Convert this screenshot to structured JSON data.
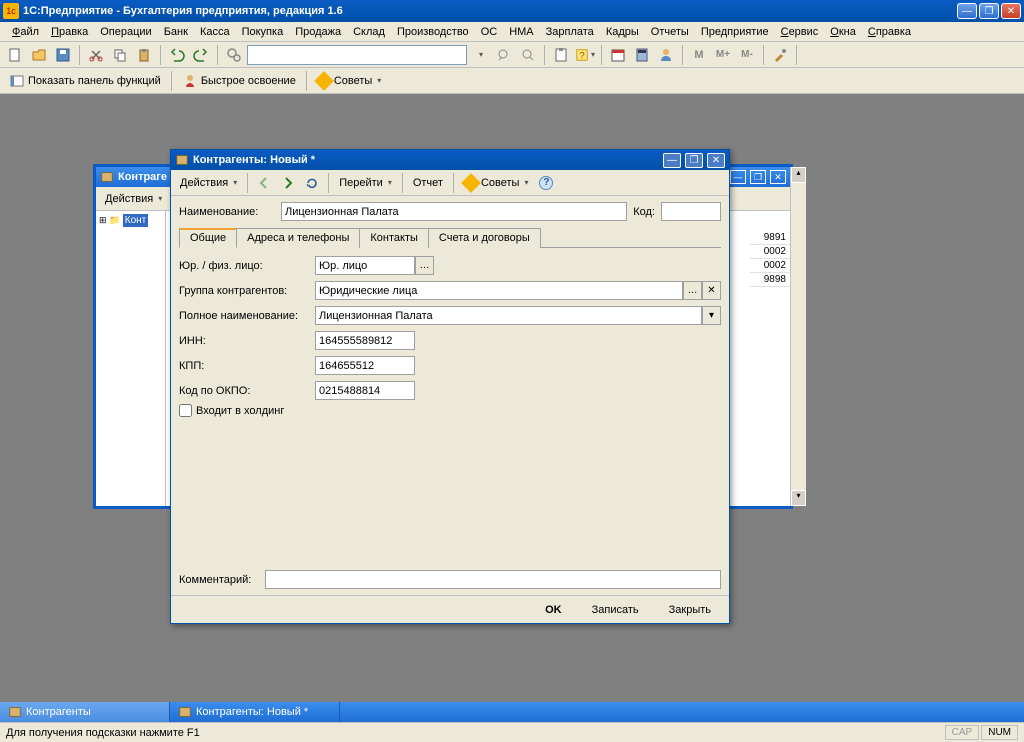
{
  "app": {
    "title": "1С:Предприятие - Бухгалтерия предприятия, редакция 1.6"
  },
  "menu": {
    "items": [
      "Файл",
      "Правка",
      "Операции",
      "Банк",
      "Касса",
      "Покупка",
      "Продажа",
      "Склад",
      "Производство",
      "ОС",
      "НМА",
      "Зарплата",
      "Кадры",
      "Отчеты",
      "Предприятие",
      "Сервис",
      "Окна",
      "Справка"
    ],
    "underlines": [
      "Ф",
      "П",
      "",
      "",
      "",
      "",
      "",
      "",
      "",
      "",
      "",
      "",
      "",
      "",
      "",
      "С",
      "О",
      "С"
    ]
  },
  "toolbar2": {
    "show_panel": "Показать панель функций",
    "quick_learn": "Быстрое освоение",
    "tips": "Советы"
  },
  "bg_window": {
    "title": "Контраге",
    "actions": "Действия",
    "tree_item": "Конт",
    "right_col": [
      "9891",
      "0002",
      "0002",
      "9898"
    ]
  },
  "dialog": {
    "title": "Контрагенты: Новый *",
    "toolbar": {
      "actions": "Действия",
      "go": "Перейти",
      "report": "Отчет",
      "tips": "Советы"
    },
    "name_lbl": "Наименование:",
    "name_val": "Лицензионная Палата",
    "code_lbl": "Код:",
    "code_val": "",
    "tabs": [
      "Общие",
      "Адреса и телефоны",
      "Контакты",
      "Счета и договоры"
    ],
    "fields": {
      "type_lbl": "Юр. / физ. лицо:",
      "type_val": "Юр. лицо",
      "group_lbl": "Группа контрагентов:",
      "group_val": "Юридические лица",
      "fullname_lbl": "Полное наименование:",
      "fullname_val": "Лицензионная Палата",
      "inn_lbl": "ИНН:",
      "inn_val": "164555589812",
      "kpp_lbl": "КПП:",
      "kpp_val": "164655512",
      "okpo_lbl": "Код по ОКПО:",
      "okpo_val": "0215488814",
      "holding_lbl": "Входит в холдинг"
    },
    "comment_lbl": "Комментарий:",
    "footer": {
      "ok": "OK",
      "save": "Записать",
      "close": "Закрыть"
    }
  },
  "taskbar": {
    "items": [
      "Контрагенты",
      "Контрагенты: Новый *"
    ]
  },
  "status": {
    "hint": "Для получения подсказки нажмите F1",
    "cap": "CAP",
    "num": "NUM"
  }
}
